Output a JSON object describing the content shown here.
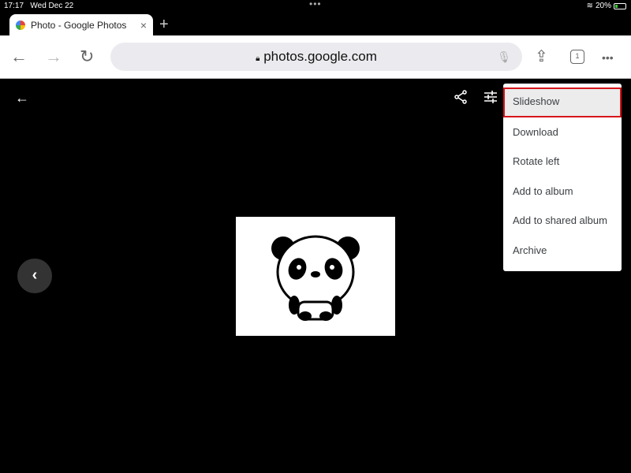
{
  "status": {
    "time": "17:17",
    "date": "Wed Dec 22",
    "battery": "20%"
  },
  "tab": {
    "title": "Photo - Google Photos",
    "close": "×",
    "new_tab": "+"
  },
  "toolbar": {
    "url": "photos.google.com",
    "tab_count": "1"
  },
  "viewer": {
    "back": "←",
    "prev": "‹"
  },
  "menu": {
    "items": [
      "Slideshow",
      "Download",
      "Rotate left",
      "Add to album",
      "Add to shared album",
      "Archive"
    ],
    "highlight_color": "#d6151b"
  }
}
